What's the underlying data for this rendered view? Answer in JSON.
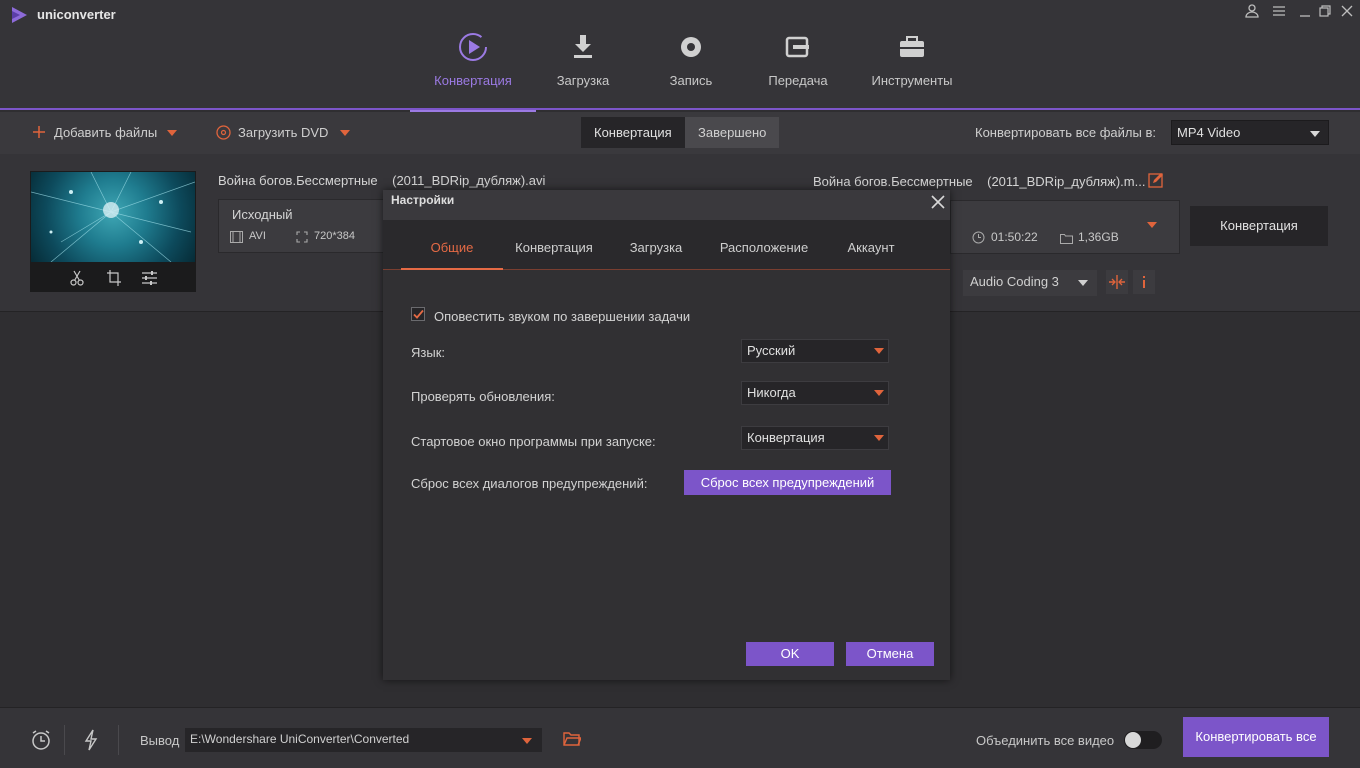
{
  "app": {
    "name": "uniconverter"
  },
  "nav": [
    {
      "label": "Конвертация",
      "icon": "convert-icon",
      "active": true
    },
    {
      "label": "Загрузка",
      "icon": "download-icon",
      "active": false
    },
    {
      "label": "Запись",
      "icon": "record-icon",
      "active": false
    },
    {
      "label": "Передача",
      "icon": "transfer-icon",
      "active": false
    },
    {
      "label": "Инструменты",
      "icon": "toolbox-icon",
      "active": false
    }
  ],
  "toolbar": {
    "add_files": "Добавить файлы",
    "load_dvd": "Загрузить DVD",
    "seg_convert": "Конвертация",
    "seg_done": "Завершено",
    "convert_all_to_label": "Конвертировать все файлы в:",
    "format": "MP4 Video"
  },
  "file": {
    "source_name": "Война богов.Бессмертные",
    "source_suffix": "(2011_BDRip_дубляж).avi",
    "target_name": "Война богов.Бессмертные",
    "target_suffix": "(2011_BDRip_дубляж).m...",
    "source_label": "Исходный",
    "format": "AVI",
    "resolution": "720*384",
    "duration": "01:50:22",
    "size": "1,36GB",
    "audio": "Audio Coding 3",
    "convert_button": "Конвертация"
  },
  "bottom": {
    "output_label": "Вывод",
    "output_path": "E:\\Wondershare UniConverter\\Converted",
    "merge_label": "Объединить все видео",
    "convert_all": "Конвертировать все"
  },
  "dialog": {
    "title": "Настройки",
    "tabs": [
      "Общие",
      "Конвертация",
      "Загрузка",
      "Расположение",
      "Аккаунт"
    ],
    "notify_label": "Оповестить звуком по завершении задачи",
    "notify_checked": true,
    "language_label": "Язык:",
    "language_value": "Русский",
    "updates_label": "Проверять обновления:",
    "updates_value": "Никогда",
    "startup_label": "Стартовое окно программы при запуске:",
    "startup_value": "Конвертация",
    "reset_label": "Сброс всех диалогов предупреждений:",
    "reset_button": "Сброс всех предупреждений",
    "ok": "OK",
    "cancel": "Отмена"
  },
  "colors": {
    "accent": "#7c55c9",
    "orange": "#e56a45",
    "bg": "#2f2e31"
  }
}
